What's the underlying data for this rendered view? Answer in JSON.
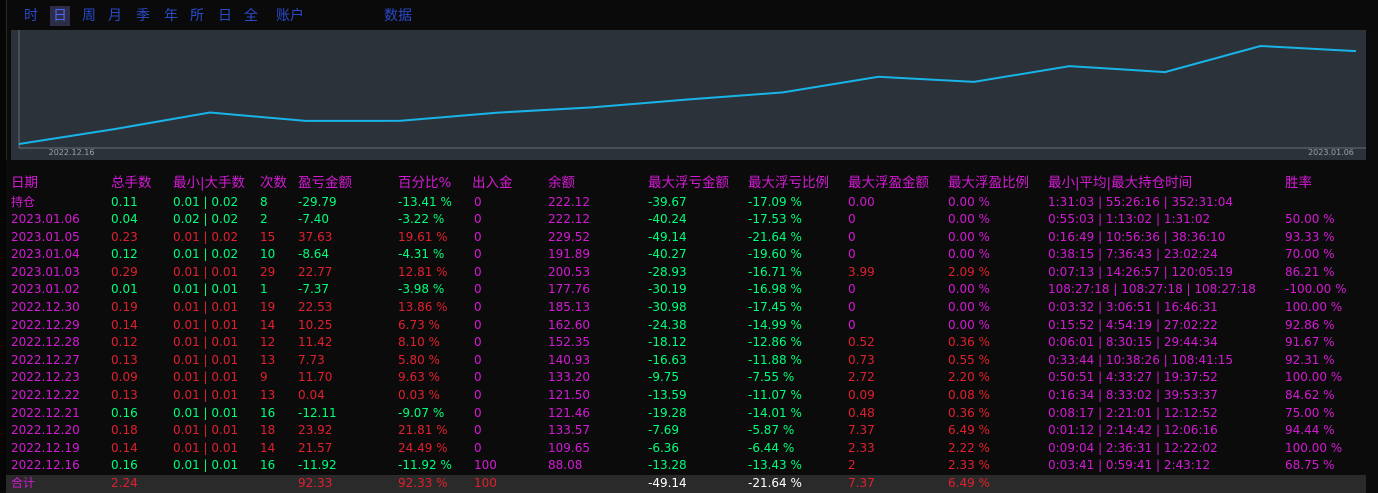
{
  "tabs": [
    {
      "label": "时",
      "active": false
    },
    {
      "label": "日",
      "active": true
    },
    {
      "label": "周",
      "active": false
    },
    {
      "label": "月",
      "active": false
    },
    {
      "label": "季",
      "active": false
    },
    {
      "label": "年",
      "active": false
    },
    {
      "label": "所",
      "active": false
    },
    {
      "label": "日",
      "active": false
    },
    {
      "label": "全",
      "active": false
    },
    {
      "label": "账户",
      "active": false
    },
    {
      "label": "数据",
      "active": false
    }
  ],
  "chart_data": {
    "type": "line",
    "x": [
      "2022.12.16",
      "2022.12.19",
      "2022.12.20",
      "2022.12.21",
      "2022.12.22",
      "2022.12.23",
      "2022.12.27",
      "2022.12.28",
      "2022.12.29",
      "2022.12.30",
      "2023.01.02",
      "2023.01.03",
      "2023.01.04",
      "2023.01.05",
      "2023.01.06"
    ],
    "y": [
      88.08,
      109.65,
      133.57,
      121.46,
      121.5,
      133.2,
      140.93,
      152.35,
      162.6,
      185.13,
      177.76,
      200.53,
      191.89,
      229.52,
      222.12
    ],
    "x_tick_labels": [
      "2022.12.16",
      "2023.01.06"
    ],
    "line_color": "#18b4e8",
    "grid": false
  },
  "table": {
    "headers": [
      "日期",
      "总手数",
      "最小|大手数",
      "次数",
      "盈亏金额",
      "百分比%",
      "出入金",
      "余额",
      "最大浮亏金额",
      "最大浮亏比例",
      "最大浮盈金额",
      "最大浮盈比例",
      "最小|平均|最大持仓时间",
      "胜率"
    ],
    "holding": {
      "date": "持仓",
      "lots": "0.11",
      "minmax": "0.01 | 0.02",
      "count": "8",
      "pnl": "-29.79",
      "pct": "-13.41 %",
      "io": "0",
      "bal": "222.12",
      "maxdd": "-39.67",
      "maxddp": "-17.09 %",
      "maxfp": "0.00",
      "maxfpp": "0.00 %",
      "time": "1:31:03 | 55:26:16 | 352:31:04",
      "win": ""
    },
    "rows": [
      {
        "date": "2023.01.06",
        "lots": "0.04",
        "minmax": "0.02 | 0.02",
        "count": "2",
        "pnl": "-7.40",
        "pct": "-3.22 %",
        "io": "0",
        "bal": "222.12",
        "maxdd": "-40.24",
        "maxddp": "-17.53 %",
        "maxfp": "0",
        "maxfpp": "0.00 %",
        "time": "0:55:03 | 1:13:02 | 1:31:02",
        "win": "50.00 %",
        "c": "green"
      },
      {
        "date": "2023.01.05",
        "lots": "0.23",
        "minmax": "0.01 | 0.02",
        "count": "15",
        "pnl": "37.63",
        "pct": "19.61 %",
        "io": "0",
        "bal": "229.52",
        "maxdd": "-49.14",
        "maxddp": "-21.64 %",
        "maxfp": "0",
        "maxfpp": "0.00 %",
        "time": "0:16:49 | 10:56:36 | 38:36:10",
        "win": "93.33 %",
        "c": "red"
      },
      {
        "date": "2023.01.04",
        "lots": "0.12",
        "minmax": "0.01 | 0.02",
        "count": "10",
        "pnl": "-8.64",
        "pct": "-4.31 %",
        "io": "0",
        "bal": "191.89",
        "maxdd": "-40.27",
        "maxddp": "-19.60 %",
        "maxfp": "0",
        "maxfpp": "0.00 %",
        "time": "0:38:15 | 7:36:43 | 23:02:24",
        "win": "70.00 %",
        "c": "green"
      },
      {
        "date": "2023.01.03",
        "lots": "0.29",
        "minmax": "0.01 | 0.01",
        "count": "29",
        "pnl": "22.77",
        "pct": "12.81 %",
        "io": "0",
        "bal": "200.53",
        "maxdd": "-28.93",
        "maxddp": "-16.71 %",
        "maxfp": "3.99",
        "maxfpp": "2.09 %",
        "time": "0:07:13 | 14:26:57 | 120:05:19",
        "win": "86.21 %",
        "c": "red"
      },
      {
        "date": "2023.01.02",
        "lots": "0.01",
        "minmax": "0.01 | 0.01",
        "count": "1",
        "pnl": "-7.37",
        "pct": "-3.98 %",
        "io": "0",
        "bal": "177.76",
        "maxdd": "-30.19",
        "maxddp": "-16.98 %",
        "maxfp": "0",
        "maxfpp": "0.00 %",
        "time": "108:27:18 | 108:27:18 | 108:27:18",
        "win": "-100.00 %",
        "c": "green"
      },
      {
        "date": "2022.12.30",
        "lots": "0.19",
        "minmax": "0.01 | 0.01",
        "count": "19",
        "pnl": "22.53",
        "pct": "13.86 %",
        "io": "0",
        "bal": "185.13",
        "maxdd": "-30.98",
        "maxddp": "-17.45 %",
        "maxfp": "0",
        "maxfpp": "0.00 %",
        "time": "0:03:32 | 3:06:51 | 16:46:31",
        "win": "100.00 %",
        "c": "red"
      },
      {
        "date": "2022.12.29",
        "lots": "0.14",
        "minmax": "0.01 | 0.01",
        "count": "14",
        "pnl": "10.25",
        "pct": "6.73 %",
        "io": "0",
        "bal": "162.60",
        "maxdd": "-24.38",
        "maxddp": "-14.99 %",
        "maxfp": "0",
        "maxfpp": "0.00 %",
        "time": "0:15:52 | 4:54:19 | 27:02:22",
        "win": "92.86 %",
        "c": "red"
      },
      {
        "date": "2022.12.28",
        "lots": "0.12",
        "minmax": "0.01 | 0.01",
        "count": "12",
        "pnl": "11.42",
        "pct": "8.10 %",
        "io": "0",
        "bal": "152.35",
        "maxdd": "-18.12",
        "maxddp": "-12.86 %",
        "maxfp": "0.52",
        "maxfpp": "0.36 %",
        "time": "0:06:01 | 8:30:15 | 29:44:34",
        "win": "91.67 %",
        "c": "red"
      },
      {
        "date": "2022.12.27",
        "lots": "0.13",
        "minmax": "0.01 | 0.01",
        "count": "13",
        "pnl": "7.73",
        "pct": "5.80 %",
        "io": "0",
        "bal": "140.93",
        "maxdd": "-16.63",
        "maxddp": "-11.88 %",
        "maxfp": "0.73",
        "maxfpp": "0.55 %",
        "time": "0:33:44 | 10:38:26 | 108:41:15",
        "win": "92.31 %",
        "c": "red"
      },
      {
        "date": "2022.12.23",
        "lots": "0.09",
        "minmax": "0.01 | 0.01",
        "count": "9",
        "pnl": "11.70",
        "pct": "9.63 %",
        "io": "0",
        "bal": "133.20",
        "maxdd": "-9.75",
        "maxddp": "-7.55 %",
        "maxfp": "2.72",
        "maxfpp": "2.20 %",
        "time": "0:50:51 | 4:33:27 | 19:37:52",
        "win": "100.00 %",
        "c": "red"
      },
      {
        "date": "2022.12.22",
        "lots": "0.13",
        "minmax": "0.01 | 0.01",
        "count": "13",
        "pnl": "0.04",
        "pct": "0.03 %",
        "io": "0",
        "bal": "121.50",
        "maxdd": "-13.59",
        "maxddp": "-11.07 %",
        "maxfp": "0.09",
        "maxfpp": "0.08 %",
        "time": "0:16:34 | 8:33:02 | 39:53:37",
        "win": "84.62 %",
        "c": "red"
      },
      {
        "date": "2022.12.21",
        "lots": "0.16",
        "minmax": "0.01 | 0.01",
        "count": "16",
        "pnl": "-12.11",
        "pct": "-9.07 %",
        "io": "0",
        "bal": "121.46",
        "maxdd": "-19.28",
        "maxddp": "-14.01 %",
        "maxfp": "0.48",
        "maxfpp": "0.36 %",
        "time": "0:08:17 | 2:21:01 | 12:12:52",
        "win": "75.00 %",
        "c": "green"
      },
      {
        "date": "2022.12.20",
        "lots": "0.18",
        "minmax": "0.01 | 0.01",
        "count": "18",
        "pnl": "23.92",
        "pct": "21.81 %",
        "io": "0",
        "bal": "133.57",
        "maxdd": "-7.69",
        "maxddp": "-5.87 %",
        "maxfp": "7.37",
        "maxfpp": "6.49 %",
        "time": "0:01:12 | 2:14:42 | 12:06:16",
        "win": "94.44 %",
        "c": "red"
      },
      {
        "date": "2022.12.19",
        "lots": "0.14",
        "minmax": "0.01 | 0.01",
        "count": "14",
        "pnl": "21.57",
        "pct": "24.49 %",
        "io": "0",
        "bal": "109.65",
        "maxdd": "-6.36",
        "maxddp": "-6.44 %",
        "maxfp": "2.33",
        "maxfpp": "2.22 %",
        "time": "0:09:04 | 2:36:31 | 12:22:02",
        "win": "100.00 %",
        "c": "red"
      },
      {
        "date": "2022.12.16",
        "lots": "0.16",
        "minmax": "0.01 | 0.01",
        "count": "16",
        "pnl": "-11.92",
        "pct": "-11.92 %",
        "io": "100",
        "bal": "88.08",
        "maxdd": "-13.28",
        "maxddp": "-13.43 %",
        "maxfp": "2",
        "maxfpp": "2.33 %",
        "time": "0:03:41 | 0:59:41 | 2:43:12",
        "win": "68.75 %",
        "c": "green"
      }
    ],
    "total": {
      "date": "合计",
      "lots": "2.24",
      "minmax": "",
      "count": "",
      "pnl": "92.33",
      "pct": "92.33 %",
      "io": "100",
      "bal": "",
      "maxdd": "-49.14",
      "maxddp": "-21.64 %",
      "maxfp": "7.37",
      "maxfpp": "6.49 %",
      "time": "",
      "win": ""
    }
  }
}
